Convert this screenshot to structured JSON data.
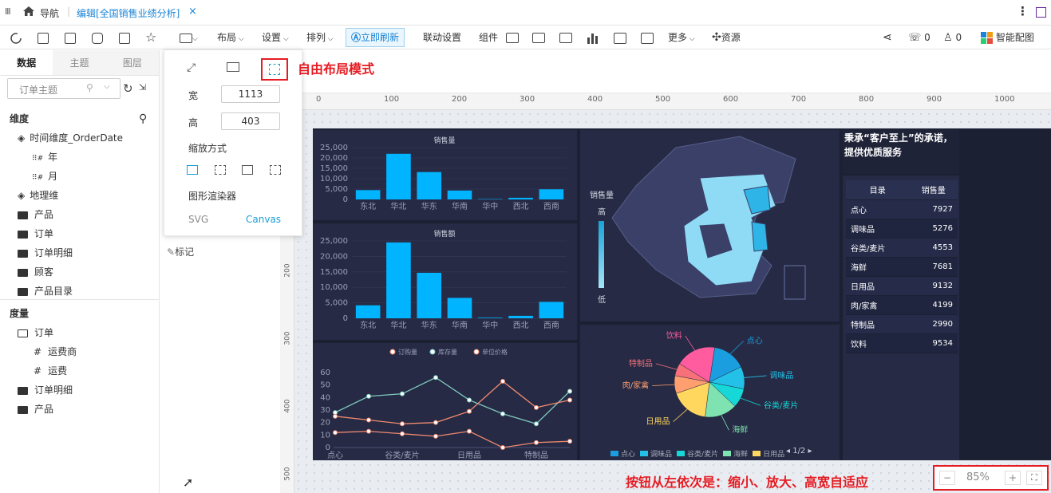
{
  "tabbar": {
    "menu": "Ⅲ",
    "nav_label": "导航",
    "sep": "|",
    "tab_label": "编辑[全国销售业绩分析]",
    "close": "×",
    "more": "⋮"
  },
  "toolbar": {
    "layout": "布局",
    "settings": "设置",
    "arrange": "排列",
    "refresh": "立即刷新",
    "linkage": "联动设置",
    "component": "组件",
    "more": "更多",
    "resource": "资源",
    "comments": "0",
    "likes": "0",
    "smart": "智能配图"
  },
  "left": {
    "tabs": [
      "数据",
      "主题",
      "图层"
    ],
    "subject_placeholder": "订单主题",
    "dim_title": "维度",
    "dims": [
      "时间维度_OrderDate",
      "年",
      "月",
      "地理维",
      "产品",
      "订单",
      "订单明细",
      "顾客",
      "产品目录"
    ],
    "measure_title": "度量",
    "measures": [
      "订单",
      "运费商",
      "运费",
      "订单明细",
      "产品"
    ]
  },
  "mid": {
    "mark": "标记"
  },
  "popup": {
    "width_label": "宽",
    "width_value": "1113",
    "height_label": "高",
    "height_value": "403",
    "scale_label": "缩放方式",
    "renderer_label": "图形渲染器",
    "svg": "SVG",
    "canvas": "Canvas"
  },
  "annotations": {
    "free_layout": "自由布局模式",
    "zoom_note": "按钮从左依次是：缩小、放大、高宽自适应"
  },
  "ruler": {
    "top": [
      "0",
      "100",
      "200",
      "300",
      "400",
      "500",
      "600",
      "700",
      "800",
      "900",
      "1000"
    ],
    "left": [
      "200",
      "300",
      "400",
      "500"
    ]
  },
  "zoom": {
    "minus": "−",
    "value": "85%",
    "plus": "+"
  },
  "dashboard": {
    "slogan": "秉承“客户至上”的承诺，提供优质服务",
    "map_legend_title": "销售量",
    "map_legend_high": "高",
    "map_legend_low": "低",
    "table": {
      "headers": [
        "目录",
        "销售量"
      ],
      "rows": [
        [
          "点心",
          "7927"
        ],
        [
          "调味品",
          "5276"
        ],
        [
          "谷类/麦片",
          "4553"
        ],
        [
          "海鲜",
          "7681"
        ],
        [
          "日用品",
          "9132"
        ],
        [
          "肉/家禽",
          "4199"
        ],
        [
          "特制品",
          "2990"
        ],
        [
          "饮料",
          "9534"
        ]
      ]
    },
    "pie_legend": [
      "点心",
      "调味品",
      "谷类/麦片",
      "海鲜",
      "日用品"
    ],
    "pie_page": "1/2"
  },
  "chart_data": [
    {
      "type": "bar",
      "title": "销售量",
      "categories": [
        "东北",
        "华北",
        "华东",
        "华南",
        "华中",
        "西北",
        "西南"
      ],
      "values": [
        4500,
        22000,
        13200,
        4300,
        200,
        800,
        4900
      ],
      "ylim": [
        0,
        25000
      ],
      "yticks": [
        "0",
        "5,000",
        "10,000",
        "15,000",
        "20,000",
        "25,000"
      ],
      "color": "#00b4ff"
    },
    {
      "type": "bar",
      "title": "销售额",
      "categories": [
        "东北",
        "华北",
        "华东",
        "华南",
        "华中",
        "西北",
        "西南"
      ],
      "values": [
        4200,
        24500,
        14700,
        6600,
        200,
        800,
        5300
      ],
      "ylim": [
        0,
        25000
      ],
      "yticks": [
        "0",
        "5,000",
        "10,000",
        "15,000",
        "20,000",
        "25,000"
      ],
      "color": "#00b4ff"
    },
    {
      "type": "line",
      "categories": [
        "点心",
        "",
        "谷类/麦片",
        "",
        "日用品",
        "",
        "特制品",
        ""
      ],
      "xticks": [
        "点心",
        "谷类/麦片",
        "日用品",
        "特制品"
      ],
      "ylim": [
        0,
        60
      ],
      "yticks": [
        "0",
        "10",
        "20",
        "30",
        "40",
        "50",
        "60"
      ],
      "series": [
        {
          "name": "订购量",
          "values": [
            12,
            13,
            11,
            9,
            13,
            0,
            4,
            5
          ],
          "color": "#f08a70"
        },
        {
          "name": "库存量",
          "values": [
            28,
            41,
            43,
            56,
            38,
            27,
            19,
            45
          ],
          "color": "#7fc9c0"
        },
        {
          "name": "单位价格",
          "values": [
            25,
            22,
            19,
            20,
            29,
            53,
            32,
            38
          ],
          "color": "#f08a70"
        }
      ]
    },
    {
      "type": "pie",
      "labels": [
        "点心",
        "调味品",
        "谷类/麦片",
        "海鲜",
        "日用品",
        "肉/家禽",
        "特制品",
        "饮料"
      ],
      "values": [
        7927,
        5276,
        4553,
        7681,
        9132,
        4199,
        2990,
        9534
      ],
      "colors": [
        "#1a9ee0",
        "#23c1e8",
        "#16d8d8",
        "#7ee3b0",
        "#ffd75e",
        "#ff9f6f",
        "#f7707a",
        "#ff5c9f"
      ]
    }
  ]
}
